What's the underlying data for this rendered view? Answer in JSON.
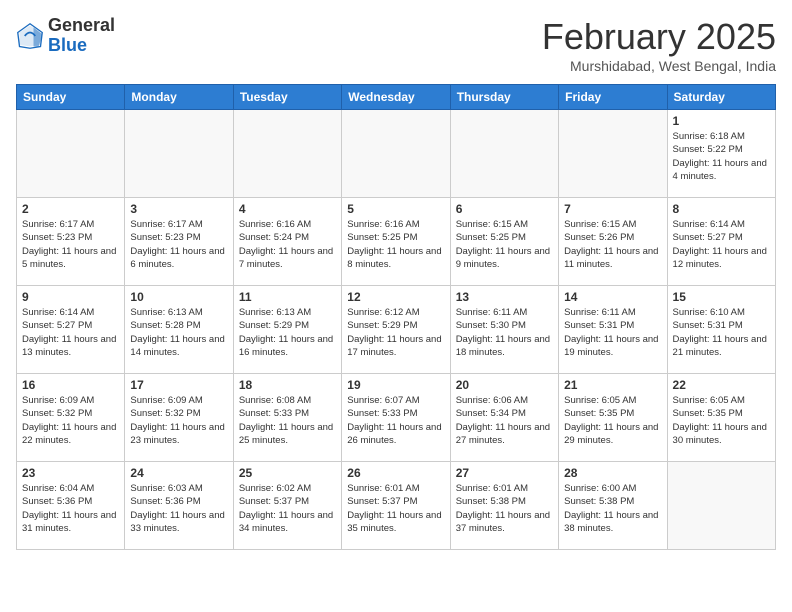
{
  "header": {
    "logo_general": "General",
    "logo_blue": "Blue",
    "month_title": "February 2025",
    "subtitle": "Murshidabad, West Bengal, India"
  },
  "weekdays": [
    "Sunday",
    "Monday",
    "Tuesday",
    "Wednesday",
    "Thursday",
    "Friday",
    "Saturday"
  ],
  "weeks": [
    [
      {
        "day": "",
        "info": ""
      },
      {
        "day": "",
        "info": ""
      },
      {
        "day": "",
        "info": ""
      },
      {
        "day": "",
        "info": ""
      },
      {
        "day": "",
        "info": ""
      },
      {
        "day": "",
        "info": ""
      },
      {
        "day": "1",
        "info": "Sunrise: 6:18 AM\nSunset: 5:22 PM\nDaylight: 11 hours and 4 minutes."
      }
    ],
    [
      {
        "day": "2",
        "info": "Sunrise: 6:17 AM\nSunset: 5:23 PM\nDaylight: 11 hours and 5 minutes."
      },
      {
        "day": "3",
        "info": "Sunrise: 6:17 AM\nSunset: 5:23 PM\nDaylight: 11 hours and 6 minutes."
      },
      {
        "day": "4",
        "info": "Sunrise: 6:16 AM\nSunset: 5:24 PM\nDaylight: 11 hours and 7 minutes."
      },
      {
        "day": "5",
        "info": "Sunrise: 6:16 AM\nSunset: 5:25 PM\nDaylight: 11 hours and 8 minutes."
      },
      {
        "day": "6",
        "info": "Sunrise: 6:15 AM\nSunset: 5:25 PM\nDaylight: 11 hours and 9 minutes."
      },
      {
        "day": "7",
        "info": "Sunrise: 6:15 AM\nSunset: 5:26 PM\nDaylight: 11 hours and 11 minutes."
      },
      {
        "day": "8",
        "info": "Sunrise: 6:14 AM\nSunset: 5:27 PM\nDaylight: 11 hours and 12 minutes."
      }
    ],
    [
      {
        "day": "9",
        "info": "Sunrise: 6:14 AM\nSunset: 5:27 PM\nDaylight: 11 hours and 13 minutes."
      },
      {
        "day": "10",
        "info": "Sunrise: 6:13 AM\nSunset: 5:28 PM\nDaylight: 11 hours and 14 minutes."
      },
      {
        "day": "11",
        "info": "Sunrise: 6:13 AM\nSunset: 5:29 PM\nDaylight: 11 hours and 16 minutes."
      },
      {
        "day": "12",
        "info": "Sunrise: 6:12 AM\nSunset: 5:29 PM\nDaylight: 11 hours and 17 minutes."
      },
      {
        "day": "13",
        "info": "Sunrise: 6:11 AM\nSunset: 5:30 PM\nDaylight: 11 hours and 18 minutes."
      },
      {
        "day": "14",
        "info": "Sunrise: 6:11 AM\nSunset: 5:31 PM\nDaylight: 11 hours and 19 minutes."
      },
      {
        "day": "15",
        "info": "Sunrise: 6:10 AM\nSunset: 5:31 PM\nDaylight: 11 hours and 21 minutes."
      }
    ],
    [
      {
        "day": "16",
        "info": "Sunrise: 6:09 AM\nSunset: 5:32 PM\nDaylight: 11 hours and 22 minutes."
      },
      {
        "day": "17",
        "info": "Sunrise: 6:09 AM\nSunset: 5:32 PM\nDaylight: 11 hours and 23 minutes."
      },
      {
        "day": "18",
        "info": "Sunrise: 6:08 AM\nSunset: 5:33 PM\nDaylight: 11 hours and 25 minutes."
      },
      {
        "day": "19",
        "info": "Sunrise: 6:07 AM\nSunset: 5:33 PM\nDaylight: 11 hours and 26 minutes."
      },
      {
        "day": "20",
        "info": "Sunrise: 6:06 AM\nSunset: 5:34 PM\nDaylight: 11 hours and 27 minutes."
      },
      {
        "day": "21",
        "info": "Sunrise: 6:05 AM\nSunset: 5:35 PM\nDaylight: 11 hours and 29 minutes."
      },
      {
        "day": "22",
        "info": "Sunrise: 6:05 AM\nSunset: 5:35 PM\nDaylight: 11 hours and 30 minutes."
      }
    ],
    [
      {
        "day": "23",
        "info": "Sunrise: 6:04 AM\nSunset: 5:36 PM\nDaylight: 11 hours and 31 minutes."
      },
      {
        "day": "24",
        "info": "Sunrise: 6:03 AM\nSunset: 5:36 PM\nDaylight: 11 hours and 33 minutes."
      },
      {
        "day": "25",
        "info": "Sunrise: 6:02 AM\nSunset: 5:37 PM\nDaylight: 11 hours and 34 minutes."
      },
      {
        "day": "26",
        "info": "Sunrise: 6:01 AM\nSunset: 5:37 PM\nDaylight: 11 hours and 35 minutes."
      },
      {
        "day": "27",
        "info": "Sunrise: 6:01 AM\nSunset: 5:38 PM\nDaylight: 11 hours and 37 minutes."
      },
      {
        "day": "28",
        "info": "Sunrise: 6:00 AM\nSunset: 5:38 PM\nDaylight: 11 hours and 38 minutes."
      },
      {
        "day": "",
        "info": ""
      }
    ]
  ]
}
